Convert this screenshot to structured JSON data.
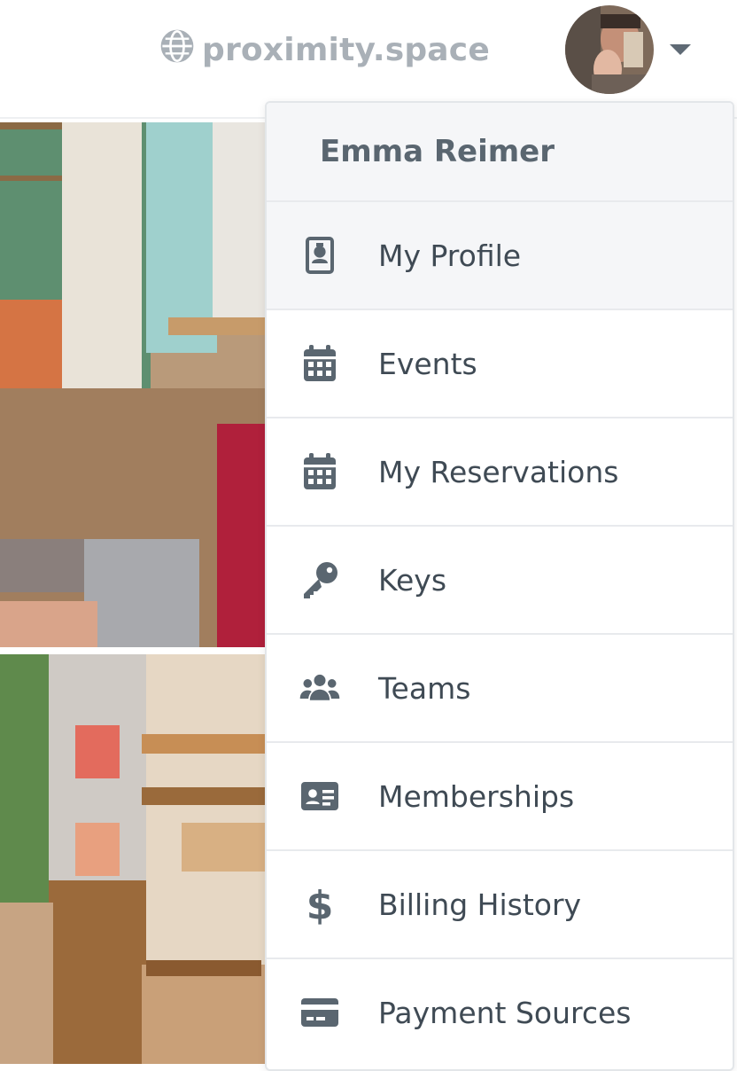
{
  "header": {
    "site_name": "proximity.space",
    "site_icon": "globe-icon"
  },
  "user_menu": {
    "user_name": "Emma Reimer",
    "items": [
      {
        "label": "My Profile",
        "icon": "id-badge-icon",
        "active": true
      },
      {
        "label": "Events",
        "icon": "calendar-icon"
      },
      {
        "label": "My Reservations",
        "icon": "calendar-icon"
      },
      {
        "label": "Keys",
        "icon": "key-icon"
      },
      {
        "label": "Teams",
        "icon": "users-icon"
      },
      {
        "label": "Memberships",
        "icon": "id-card-icon"
      },
      {
        "label": "Billing History",
        "icon": "dollar-icon"
      },
      {
        "label": "Payment Sources",
        "icon": "credit-card-icon"
      }
    ]
  },
  "colors": {
    "icon": "#5a6670",
    "text": "#3f4a54",
    "muted": "#a9b0b7",
    "active_bg": "#f5f6f8"
  }
}
